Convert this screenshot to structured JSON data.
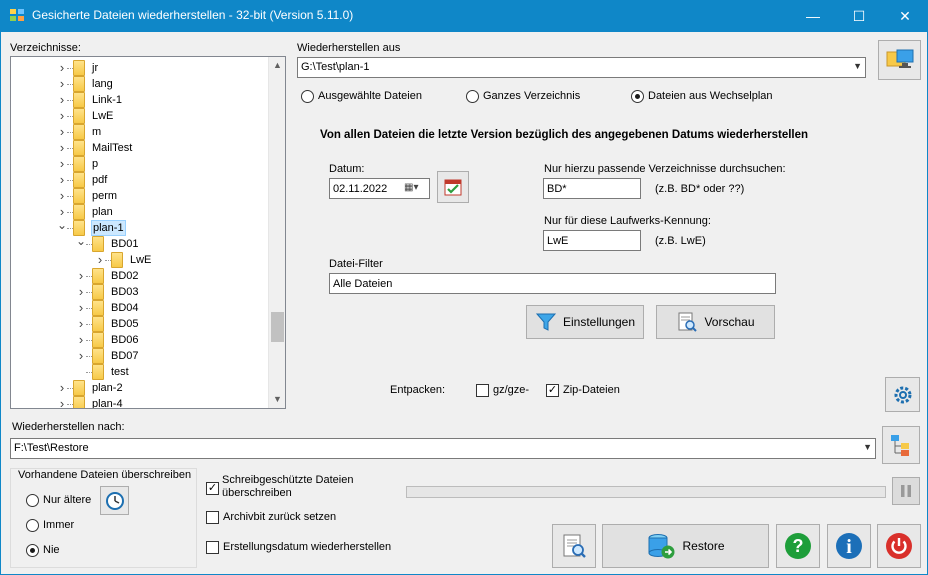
{
  "window": {
    "title": "Gesicherte Dateien wiederherstellen - 32-bit (Version 5.11.0)",
    "minimize": "—",
    "maximize": "☐",
    "close": "✕"
  },
  "tree": {
    "label": "Verzeichnisse:",
    "items": [
      {
        "label": "jr"
      },
      {
        "label": "lang"
      },
      {
        "label": "Link-1"
      },
      {
        "label": "LwE"
      },
      {
        "label": "m"
      },
      {
        "label": "MailTest"
      },
      {
        "label": "p"
      },
      {
        "label": "pdf"
      },
      {
        "label": "perm"
      },
      {
        "label": "plan"
      },
      {
        "label": "plan-1"
      },
      {
        "label": "BD01"
      },
      {
        "label": "LwE"
      },
      {
        "label": "BD02"
      },
      {
        "label": "BD03"
      },
      {
        "label": "BD04"
      },
      {
        "label": "BD05"
      },
      {
        "label": "BD06"
      },
      {
        "label": "BD07"
      },
      {
        "label": "test"
      },
      {
        "label": "plan-2"
      },
      {
        "label": "plan-4"
      }
    ]
  },
  "restore_from": {
    "label": "Wiederherstellen aus",
    "value": "G:\\Test\\plan-1",
    "modes": [
      {
        "label": "Ausgewählte Dateien",
        "selected": false
      },
      {
        "label": "Ganzes Verzeichnis",
        "selected": false
      },
      {
        "label": "Dateien aus Wechselplan",
        "selected": true
      }
    ]
  },
  "options": {
    "heading": "Von allen Dateien die letzte Version bezüglich des angegebenen Datums wiederherstellen",
    "date_label": "Datum:",
    "date_value": "02.11.2022",
    "dir_filter_label": "Nur hierzu passende Verzeichnisse durchsuchen:",
    "dir_filter_value": "BD*",
    "dir_filter_hint": "(z.B. BD* oder ??)",
    "drive_label": "Nur für diese Laufwerks-Kennung:",
    "drive_value": "LwE",
    "drive_hint": "(z.B. LwE)",
    "file_filter_label": "Datei-Filter",
    "file_filter_value": "Alle Dateien",
    "settings_button": "Einstellungen",
    "preview_button": "Vorschau",
    "unpack_label": "Entpacken:",
    "gz_label": "gz/gze-",
    "gz_checked": false,
    "zip_label": "Zip-Dateien",
    "zip_checked": true
  },
  "restore_to": {
    "label": "Wiederherstellen nach:",
    "value": "F:\\Test\\Restore"
  },
  "overwrite": {
    "group_label": "Vorhandene Dateien überschreiben",
    "options": [
      {
        "label": "Nur ältere",
        "selected": false
      },
      {
        "label": "Immer",
        "selected": false
      },
      {
        "label": "Nie",
        "selected": true
      }
    ]
  },
  "flags": {
    "readonly_label_1": "Schreibgeschützte Dateien",
    "readonly_label_2": "überschreiben",
    "readonly_checked": true,
    "archive_label": "Archivbit zurück setzen",
    "archive_checked": false,
    "created_label": "Erstellungsdatum wiederherstellen",
    "created_checked": false
  },
  "actions": {
    "restore_label": "Restore"
  },
  "colors": {
    "titlebar": "#0f87c8",
    "selection": "#cce8ff",
    "help_green": "#1e9e3a",
    "info_blue": "#1c6fb8",
    "exit_red": "#d9302b"
  }
}
